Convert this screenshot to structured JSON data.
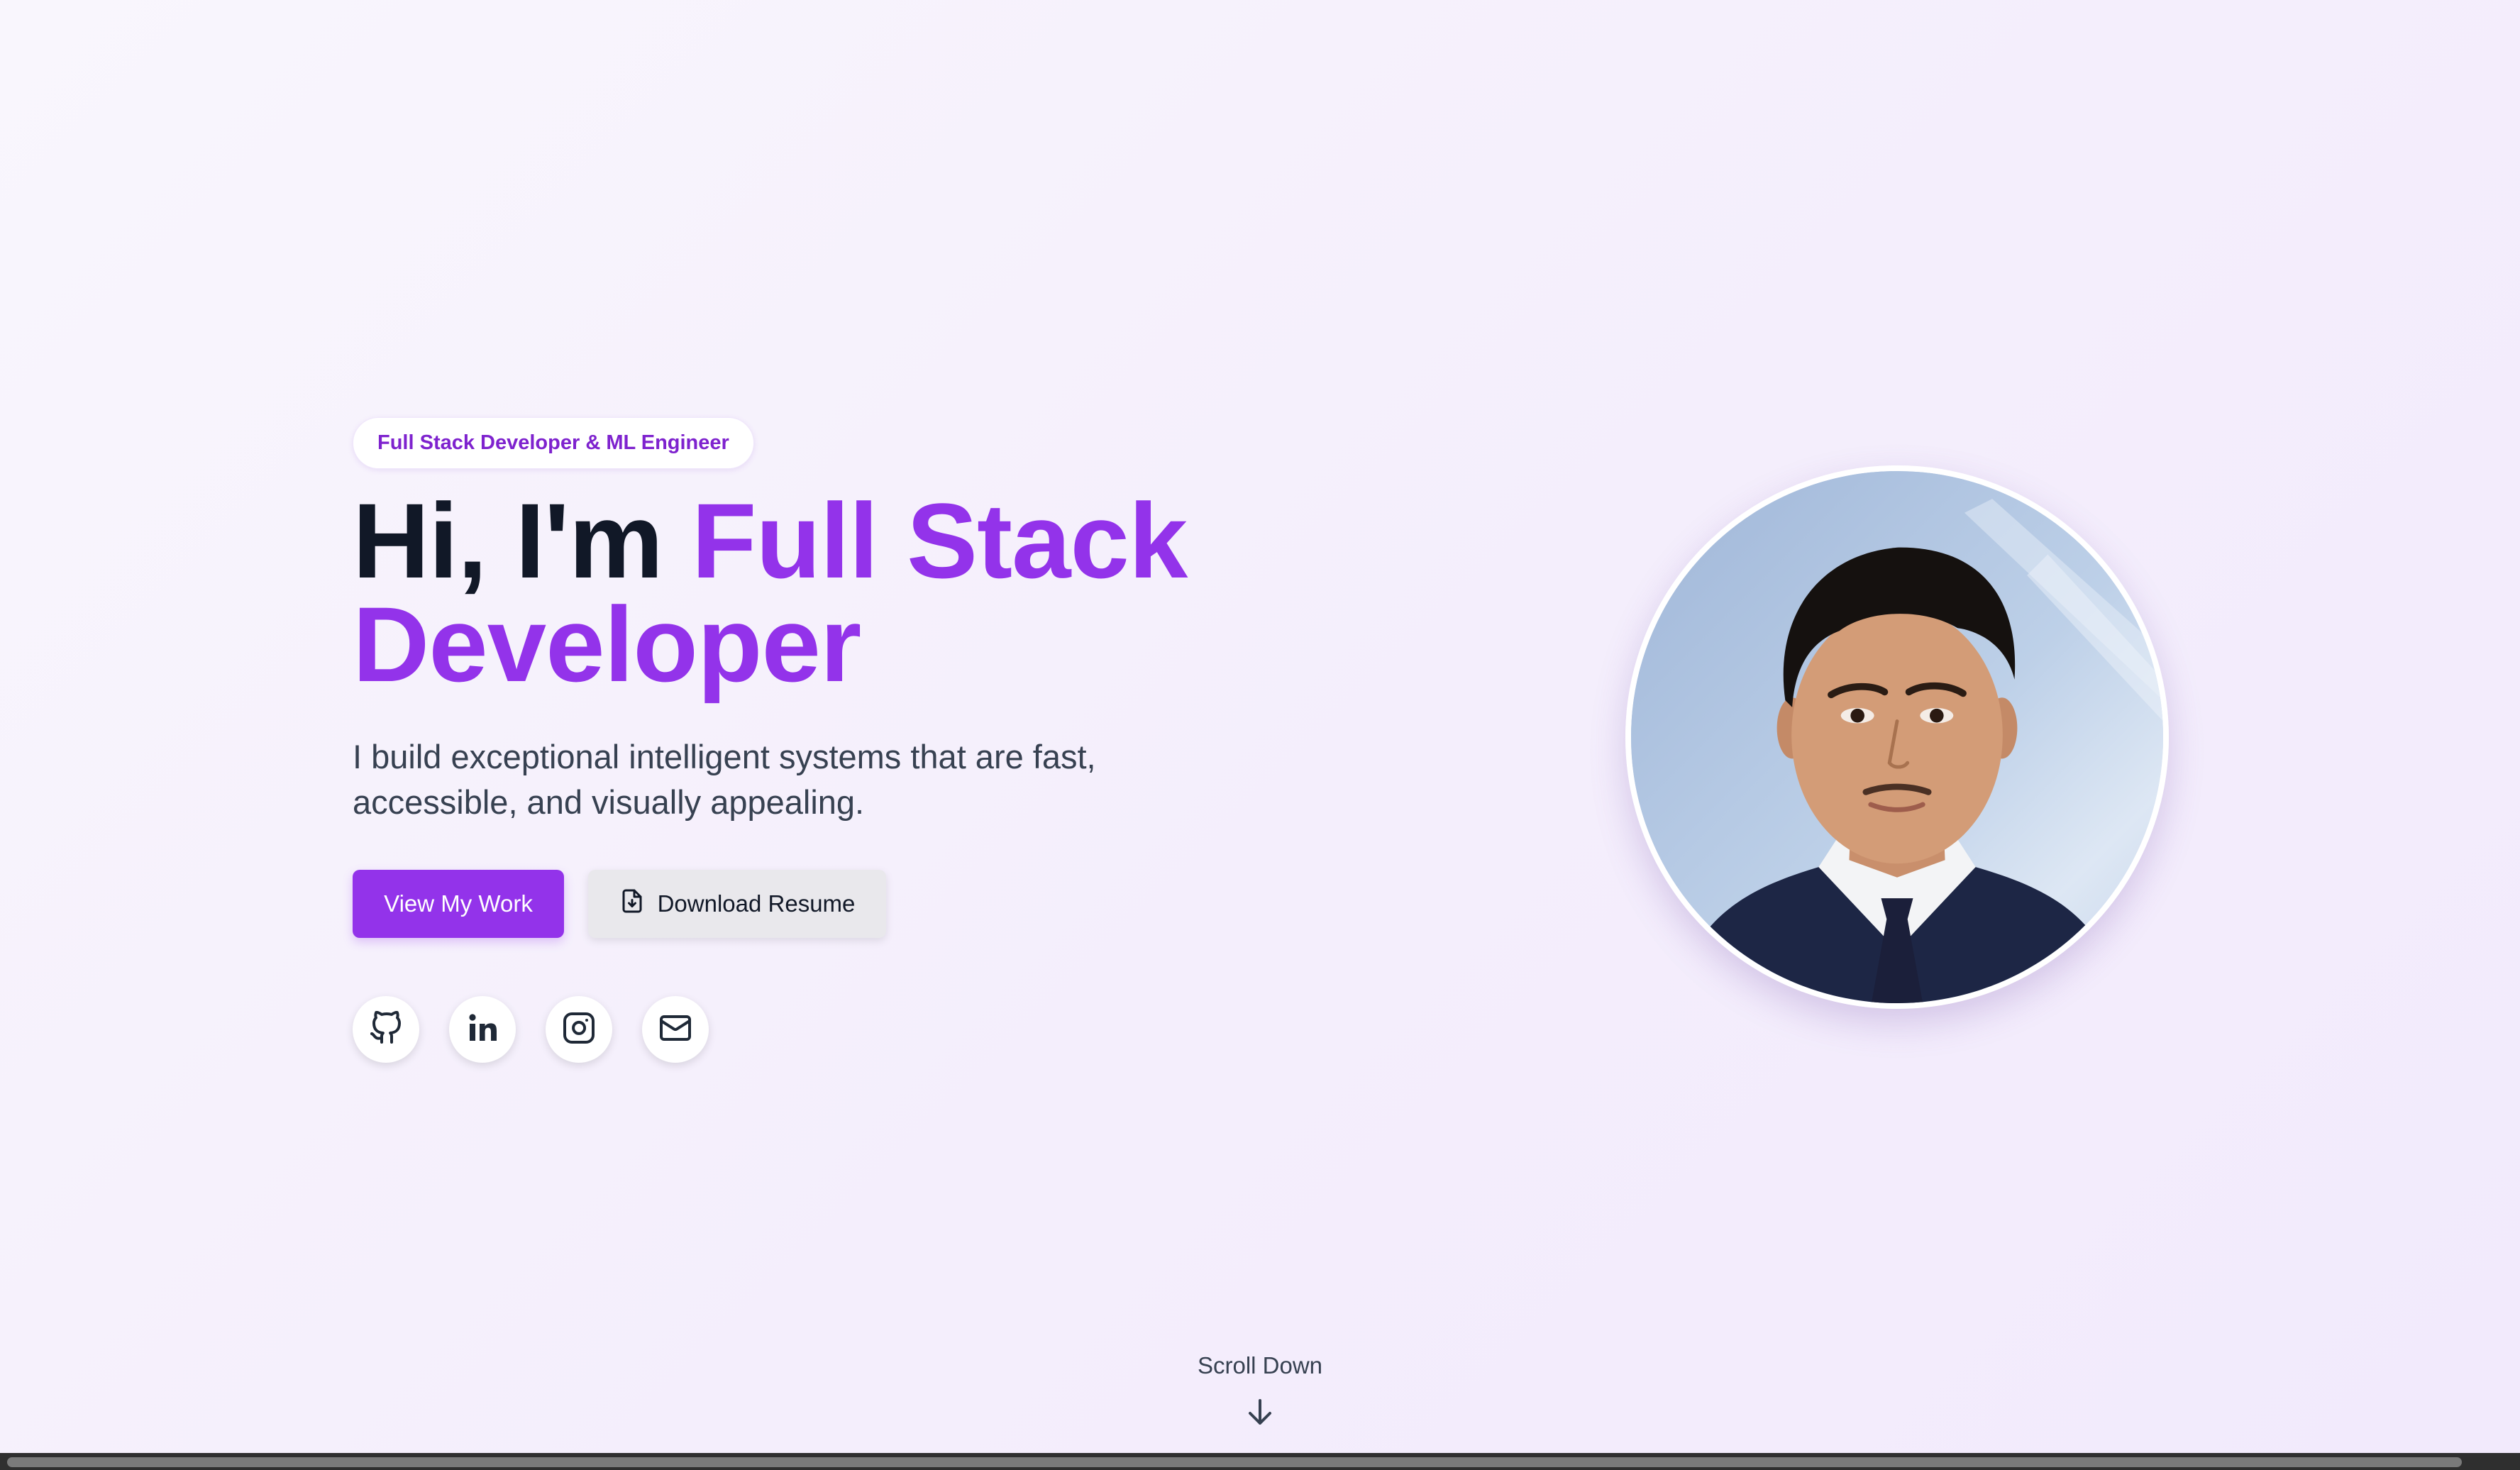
{
  "hero": {
    "badge": "Full Stack Developer & ML Engineer",
    "greeting": "Hi, I'm ",
    "role_line1": "Full Stack",
    "role_line2": "Developer",
    "tagline": "I build exceptional intelligent systems that are fast, accessible, and visually appealing.",
    "primary_button": "View My Work",
    "secondary_button": "Download Resume",
    "secondary_button_icon": "file-download-icon"
  },
  "socials": [
    {
      "icon": "github-icon"
    },
    {
      "icon": "linkedin-icon"
    },
    {
      "icon": "instagram-icon"
    },
    {
      "icon": "mail-icon"
    }
  ],
  "portrait": {
    "icon": "profile-photo"
  },
  "scroll": {
    "label": "Scroll Down",
    "icon": "arrow-down-icon"
  },
  "colors": {
    "accent": "#9333ea",
    "heading": "#111827",
    "body_text": "#374151",
    "background": "#f5f0fc"
  }
}
